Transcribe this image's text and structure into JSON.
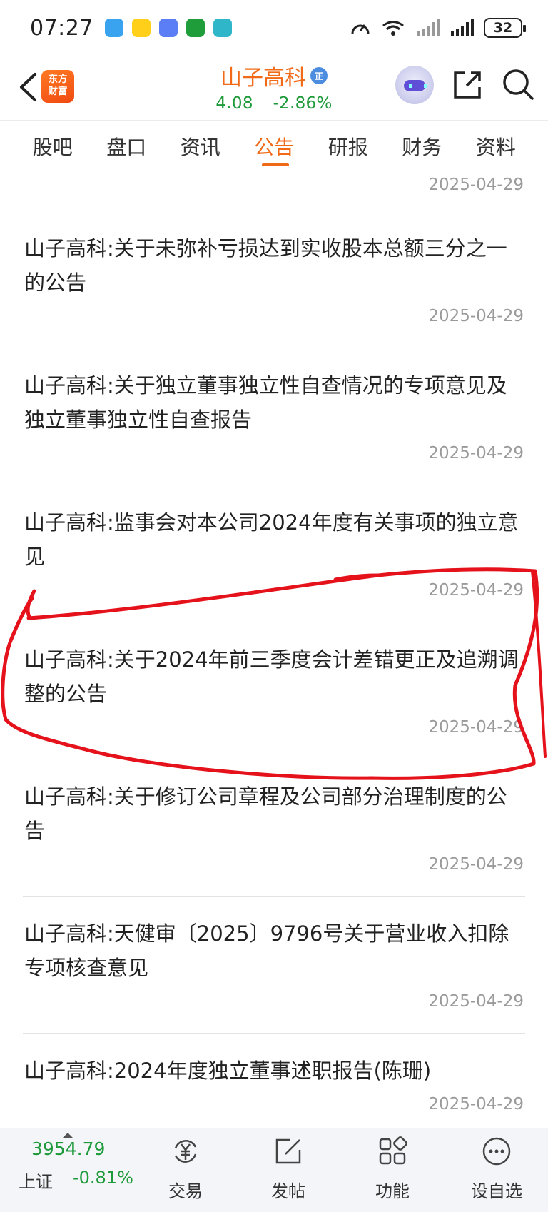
{
  "status_bar": {
    "time": "07:27",
    "battery": "32"
  },
  "header": {
    "logo_text": [
      "东方",
      "财富"
    ],
    "stock_name": "山子高科",
    "badge": "正",
    "price": "4.08",
    "change_pct": "-2.86%"
  },
  "tabs": [
    "股吧",
    "盘口",
    "资讯",
    "公告",
    "研报",
    "财务",
    "资料"
  ],
  "active_tab": "公告",
  "list": {
    "top_date": "2025-04-29",
    "items": [
      {
        "title": "山子高科:关于未弥补亏损达到实收股本总额三分之一的公告",
        "date": "2025-04-29"
      },
      {
        "title": "山子高科:关于独立董事独立性自查情况的专项意见及独立董事独立性自查报告",
        "date": "2025-04-29"
      },
      {
        "title": "山子高科:监事会对本公司2024年度有关事项的独立意见",
        "date": "2025-04-29"
      },
      {
        "title": "山子高科:关于2024年前三季度会计差错更正及追溯调整的公告",
        "date": "2025-04-29"
      },
      {
        "title": "山子高科:关于修订公司章程及公司部分治理制度的公告",
        "date": "2025-04-29"
      },
      {
        "title": "山子高科:天健审〔2025〕9796号关于营业收入扣除专项核查意见",
        "date": "2025-04-29"
      },
      {
        "title": "山子高科:2024年度独立董事述职报告(陈珊)",
        "date": "2025-04-29"
      }
    ]
  },
  "bottom_bar": {
    "index_value": "3954.79",
    "index_name": "上证",
    "index_change": "-0.81%",
    "buttons": [
      "交易",
      "发帖",
      "功能",
      "设自选"
    ]
  },
  "colors": {
    "accent": "#f06a17",
    "down": "#1e9a3a",
    "annotation": "#e5121b"
  }
}
